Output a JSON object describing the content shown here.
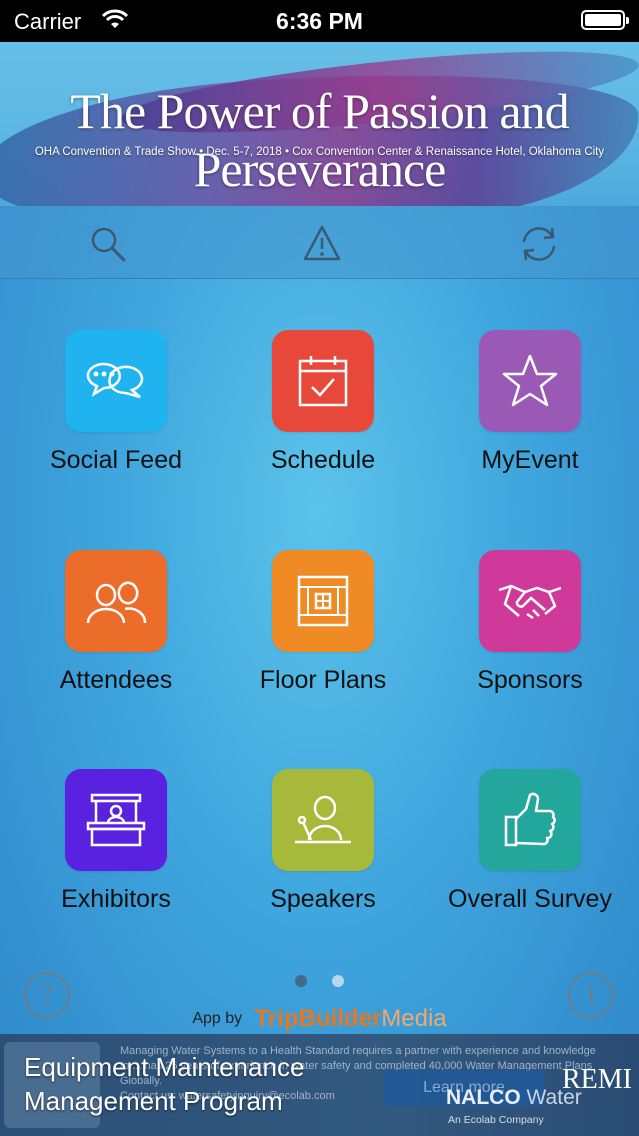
{
  "status_bar": {
    "carrier": "Carrier",
    "time": "6:36 PM"
  },
  "banner": {
    "title": "The Power of Passion and Perseverance",
    "subtitle": "OHA Convention & Trade Show • Dec. 5-7, 2018 • Cox Convention Center & Renaissance Hotel, Oklahoma City"
  },
  "toolbar": {
    "icons": [
      "search-icon",
      "alert-icon",
      "refresh-icon"
    ]
  },
  "grid": {
    "items": [
      {
        "label": "Social Feed",
        "icon": "chat-bubbles-icon",
        "color": "#1fb4f0"
      },
      {
        "label": "Schedule",
        "icon": "calendar-check-icon",
        "color": "#e8483a"
      },
      {
        "label": "MyEvent",
        "icon": "star-icon",
        "color": "#9b59b6"
      },
      {
        "label": "Attendees",
        "icon": "people-icon",
        "color": "#ec6c2a"
      },
      {
        "label": "Floor Plans",
        "icon": "floor-plan-icon",
        "color": "#f08a24"
      },
      {
        "label": "Sponsors",
        "icon": "handshake-icon",
        "color": "#cf3a9a"
      },
      {
        "label": "Exhibitors",
        "icon": "booth-icon",
        "color": "#5a22e0"
      },
      {
        "label": "Speakers",
        "icon": "speaker-icon",
        "color": "#a7b93a"
      },
      {
        "label": "Overall Survey",
        "icon": "thumbs-up-icon",
        "color": "#23a69c"
      }
    ]
  },
  "pager": {
    "current": 1,
    "total": 2
  },
  "footer": {
    "help_symbol": "?",
    "info_symbol": "i",
    "credit_prefix": "App by",
    "credit_brand_a": "TripBuilder",
    "credit_brand_b": "Media"
  },
  "ad": {
    "heading_line1": "Equipment Maintenance",
    "heading_line2": "Management Program",
    "body": "Managing Water Systems to a Health Standard requires a partner with experience and knowledge to ... has 25 years of experience in water safety and completed 40,000 Water Management Plans Globally.",
    "contact": "Contact us: watersafetyinquiry@ecolab.com",
    "cta": "Learn more",
    "brand_a": "NALCO",
    "brand_b": "Water",
    "brand_tag": "An Ecolab Company",
    "partner": "REMI"
  }
}
